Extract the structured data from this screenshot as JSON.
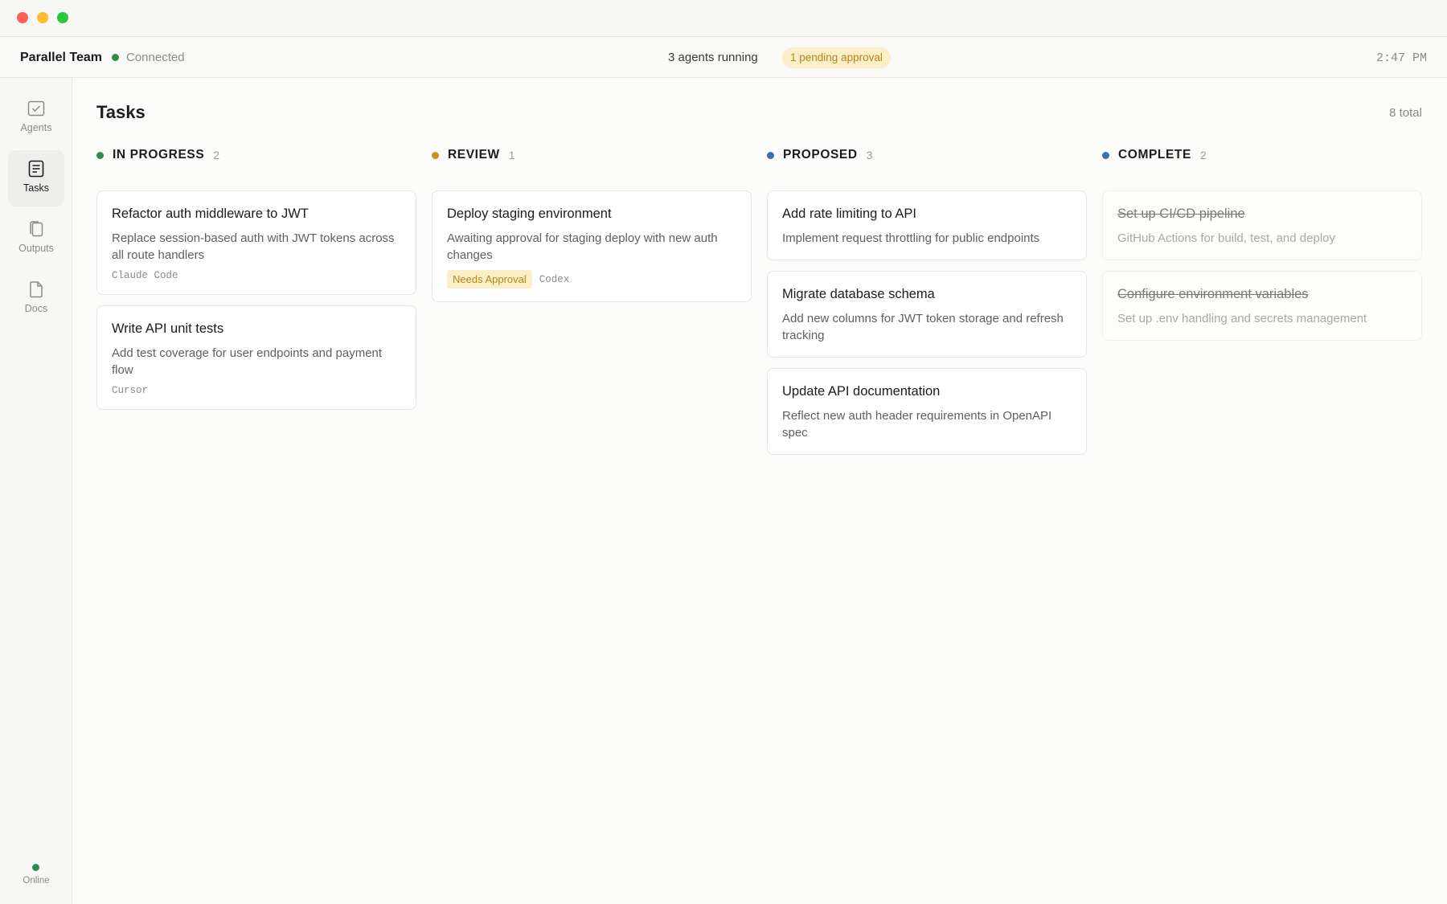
{
  "header": {
    "team_name": "Parallel Team",
    "connection_status": "Connected",
    "agents_running": "3 agents running",
    "pending_approval": "1 pending approval",
    "time": "2:47 PM"
  },
  "sidebar": {
    "items": [
      {
        "label": "Agents",
        "icon": "checkbox-icon",
        "active": false
      },
      {
        "label": "Tasks",
        "icon": "list-document-icon",
        "active": true
      },
      {
        "label": "Outputs",
        "icon": "copy-icon",
        "active": false
      },
      {
        "label": "Docs",
        "icon": "file-icon",
        "active": false
      }
    ],
    "online_label": "Online"
  },
  "main": {
    "title": "Tasks",
    "total": "8 total",
    "columns": [
      {
        "name": "IN PROGRESS",
        "count": "2",
        "color": "#2e8b4e",
        "cards": [
          {
            "title": "Refactor auth middleware to JWT",
            "description": "Replace session-based auth with JWT tokens across all route handlers",
            "agent": "Claude Code"
          },
          {
            "title": "Write API unit tests",
            "description": "Add test coverage for user endpoints and payment flow",
            "agent": "Cursor"
          }
        ]
      },
      {
        "name": "REVIEW",
        "count": "1",
        "color": "#c9921e",
        "cards": [
          {
            "title": "Deploy staging environment",
            "description": "Awaiting approval for staging deploy with new auth changes",
            "tag": "Needs Approval",
            "agent": "Codex"
          }
        ]
      },
      {
        "name": "PROPOSED",
        "count": "3",
        "color": "#3a6fb0",
        "cards": [
          {
            "title": "Add rate limiting to API",
            "description": "Implement request throttling for public endpoints"
          },
          {
            "title": "Migrate database schema",
            "description": "Add new columns for JWT token storage and refresh tracking"
          },
          {
            "title": "Update API documentation",
            "description": "Reflect new auth header requirements in OpenAPI spec"
          }
        ]
      },
      {
        "name": "COMPLETE",
        "count": "2",
        "color": "#3a6fb0",
        "cards": [
          {
            "title": "Set up CI/CD pipeline",
            "description": "GitHub Actions for build, test, and deploy"
          },
          {
            "title": "Configure environment variables",
            "description": "Set up .env handling and secrets management"
          }
        ]
      }
    ]
  },
  "colors": {
    "online": "#2e8b4e",
    "pending_bg": "#fbefc8",
    "pending_text": "#b88612"
  }
}
